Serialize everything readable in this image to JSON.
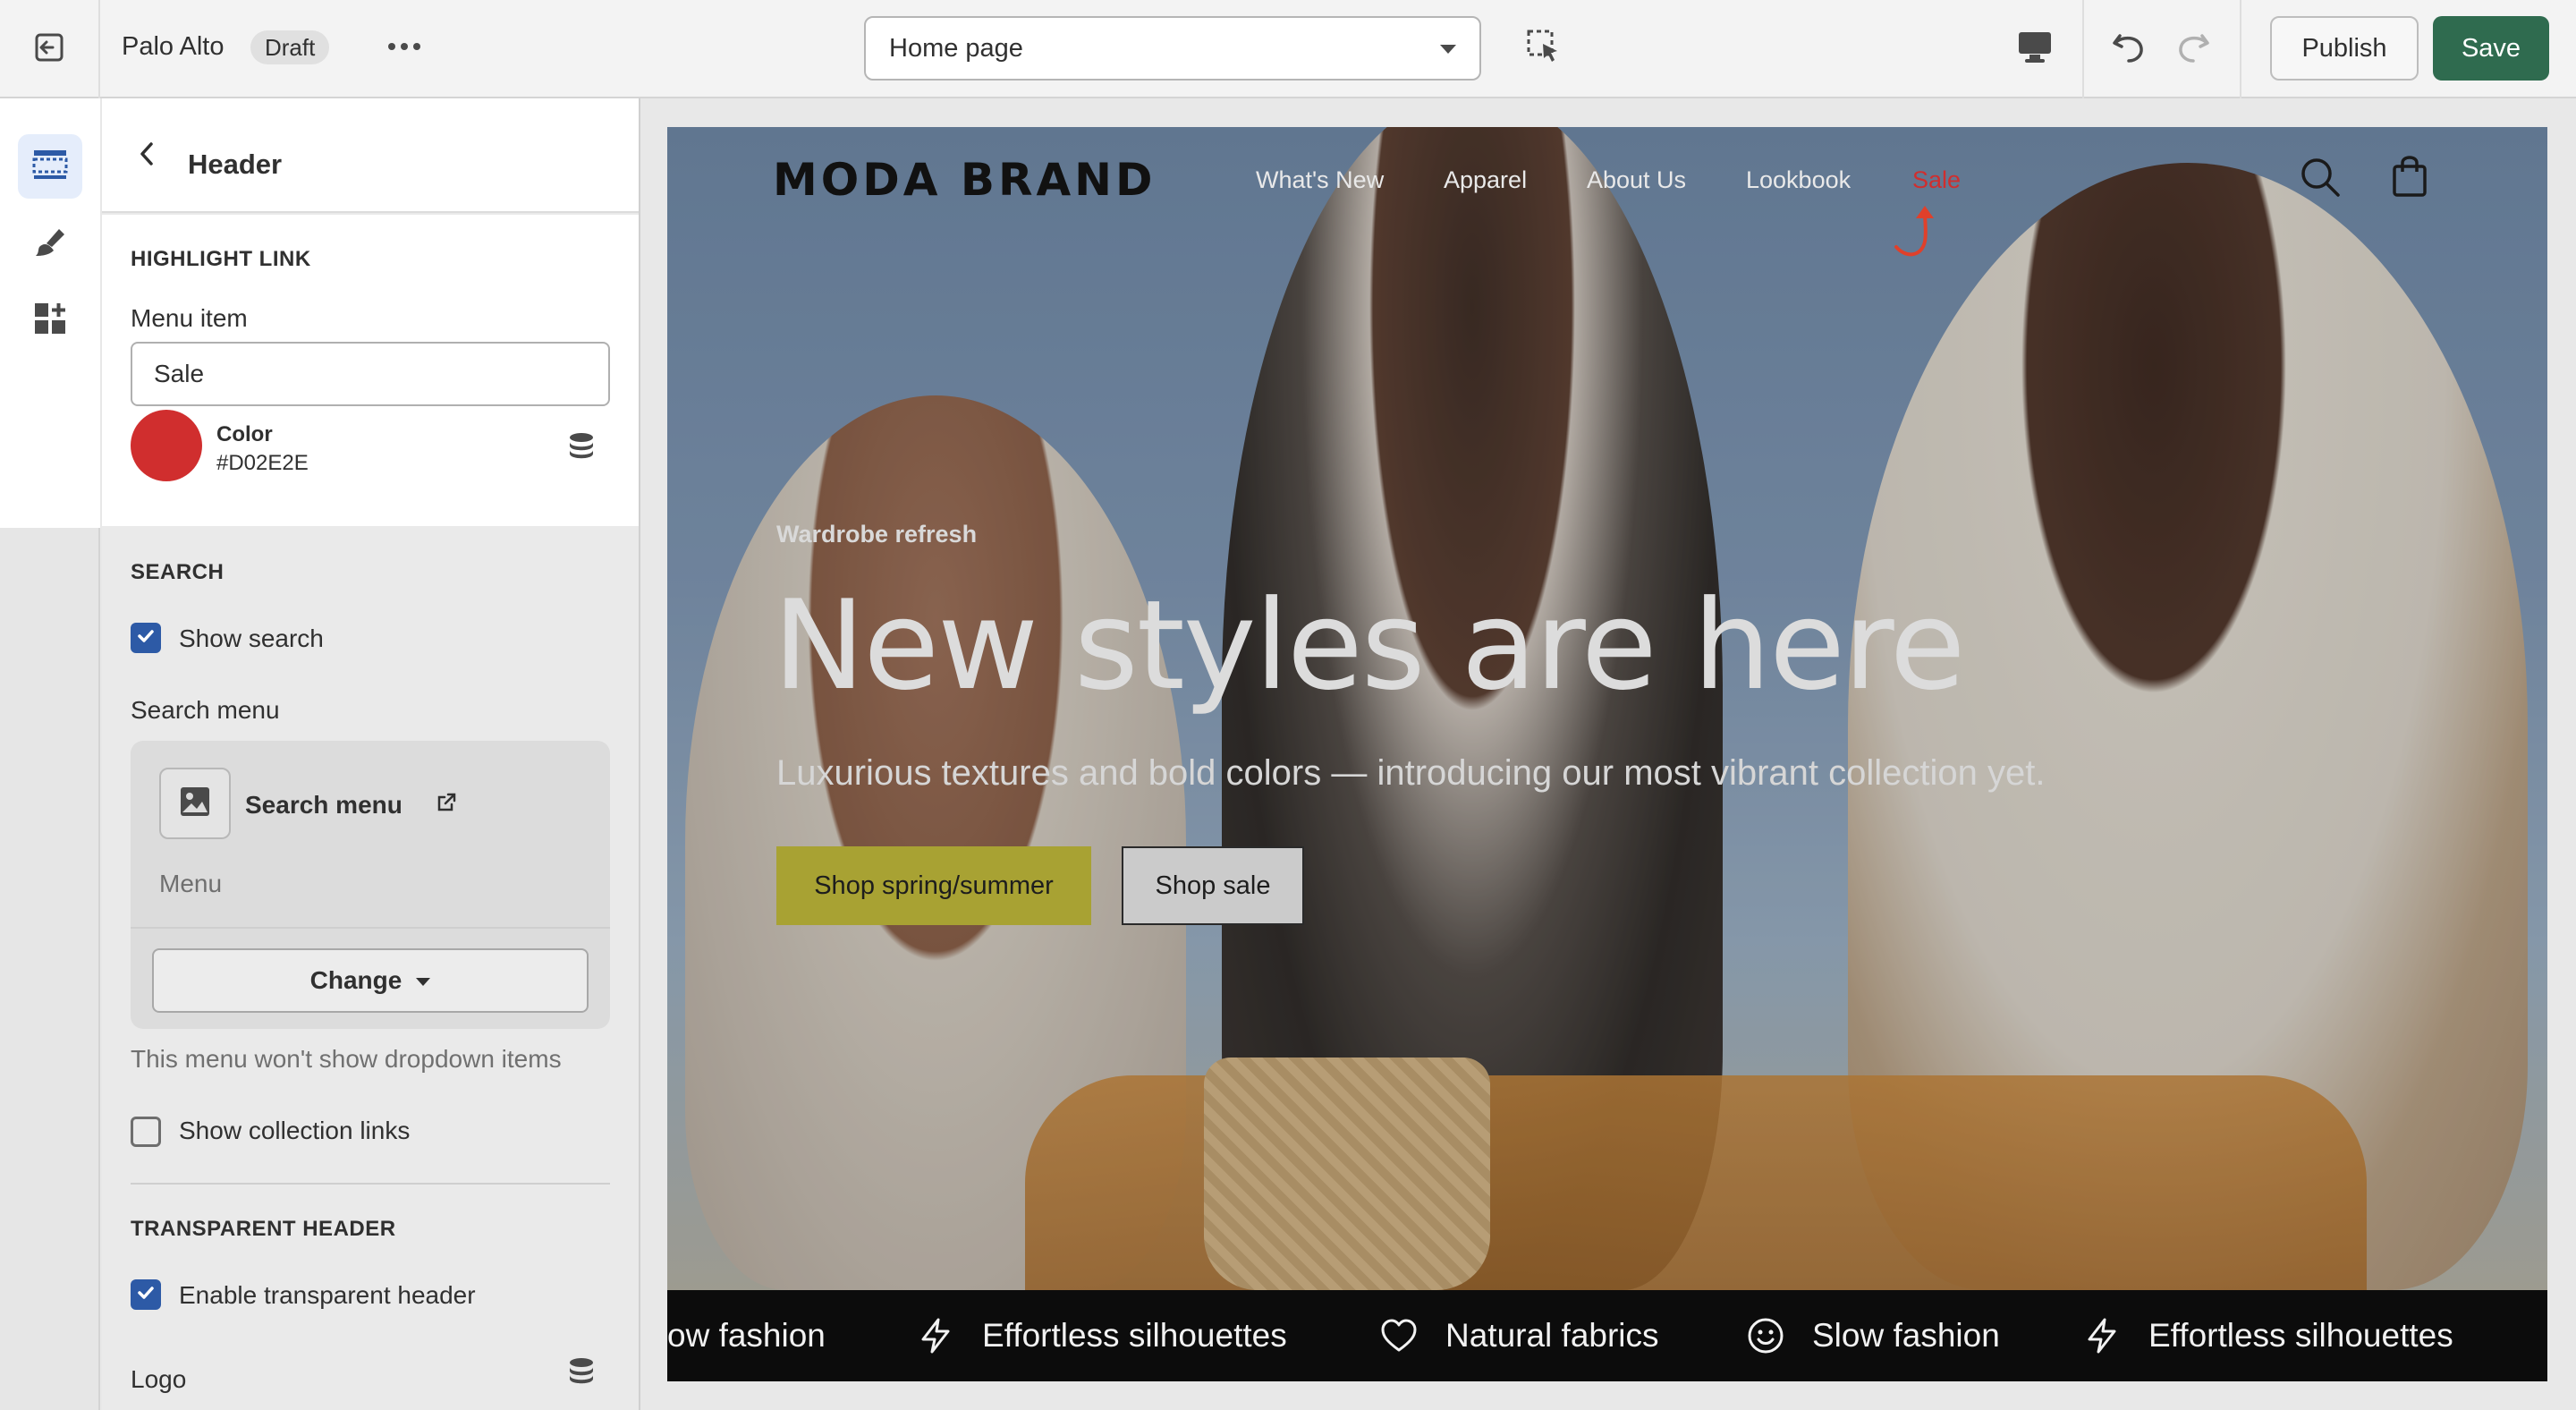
{
  "topbar": {
    "store_name": "Palo Alto",
    "status_badge": "Draft",
    "page_selector": "Home page",
    "publish_label": "Publish",
    "save_label": "Save",
    "icons": [
      "exit-icon",
      "more-icon",
      "chevron-down-icon",
      "inspect-icon",
      "desktop-icon",
      "undo-icon",
      "redo-icon"
    ]
  },
  "rail": {
    "items": [
      "sections-icon",
      "theme-settings-icon",
      "apps-icon"
    ],
    "active_index": 0
  },
  "panel": {
    "title": "Header",
    "highlight": {
      "section_title": "HIGHLIGHT LINK",
      "menu_item_label": "Menu item",
      "menu_item_value": "Sale",
      "color_label": "Color",
      "color_value": "#D02E2E"
    },
    "search": {
      "section_title": "SEARCH",
      "show_search_label": "Show search",
      "show_search_checked": true,
      "search_menu_label": "Search menu",
      "card_title": "Search menu",
      "card_subtitle": "Menu",
      "change_label": "Change",
      "help_text": "This menu won't show dropdown items",
      "show_collection_label": "Show collection links",
      "show_collection_checked": false
    },
    "transparent": {
      "section_title": "TRANSPARENT HEADER",
      "enable_label": "Enable transparent header",
      "enable_checked": true,
      "logo_label": "Logo"
    }
  },
  "preview": {
    "logo": "MODA BRAND",
    "nav": [
      "What's New",
      "Apparel",
      "About Us",
      "Lookbook",
      "Sale"
    ],
    "highlight_color": "#D02E2E",
    "eyebrow": "Wardrobe refresh",
    "title": "New styles are here",
    "subtitle": "Luxurious textures and bold colors — introducing our most vibrant collection yet.",
    "primary_button": "Shop spring/summer",
    "secondary_button": "Shop sale",
    "marquee": [
      {
        "icon": "smile-icon",
        "text": "ow fashion"
      },
      {
        "icon": "lightning-icon",
        "text": "Effortless silhouettes"
      },
      {
        "icon": "heart-icon",
        "text": "Natural fabrics"
      },
      {
        "icon": "smile-icon",
        "text": "Slow fashion"
      },
      {
        "icon": "lightning-icon",
        "text": "Effortless silhouettes"
      }
    ]
  },
  "colors": {
    "accent": "#2D5AA6",
    "save_button": "#2F6B4F",
    "primary_cta": "#A8A233",
    "marquee_bg": "#0C0C0C"
  }
}
